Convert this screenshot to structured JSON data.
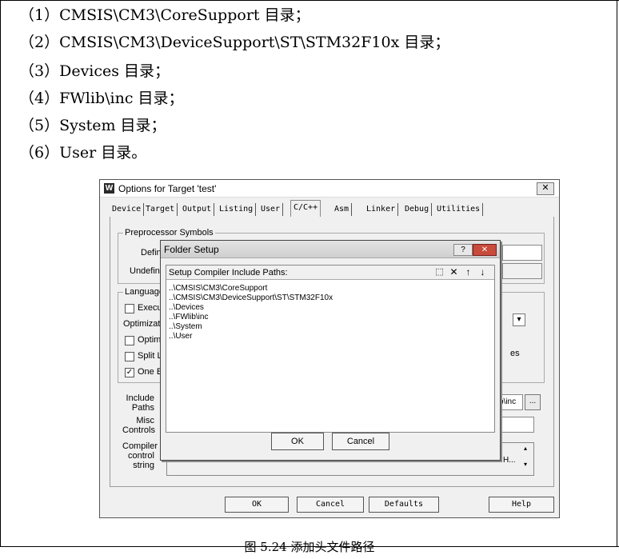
{
  "doc": {
    "lines": [
      "（1）CMSIS\\CM3\\CoreSupport 目录；",
      "（2）CMSIS\\CM3\\DeviceSupport\\ST\\STM32F10x 目录；",
      "（3）Devices 目录；",
      "（4）FWlib\\inc 目录；",
      "（5）System 目录；",
      "（6）User 目录。"
    ],
    "caption": "图 5.24   添加头文件路径"
  },
  "dialog": {
    "title": "Options for Target 'test'",
    "app_icon": "W",
    "close": "✕",
    "tabs": [
      "Device",
      "Target",
      "Output",
      "Listing",
      "User",
      "C/C++",
      "Asm",
      "Linker",
      "Debug",
      "Utilities"
    ],
    "active_tab": "C/C++",
    "preprocessor": {
      "group": "Preprocessor Symbols",
      "define": "Define",
      "undefine": "Undefine"
    },
    "language": {
      "group": "Language",
      "execute": "Execu",
      "optimization": "Optimizatic",
      "optimize": "Optim",
      "split": "Split L",
      "one": "One E",
      "right_dropdown": "▾",
      "right_text": "es"
    },
    "include_paths": {
      "label1": "Include",
      "label2": "Paths",
      "value": "b\\inc",
      "browse": "..."
    },
    "misc_controls": {
      "label1": "Misc",
      "label2": "Controls"
    },
    "compiler_string": {
      "label1": "Compiler",
      "label2": "control",
      "label3": "string",
      "value": "H..."
    },
    "buttons": {
      "ok": "OK",
      "cancel": "Cancel",
      "defaults": "Defaults",
      "help": "Help"
    }
  },
  "folder_setup": {
    "title": "Folder Setup",
    "help": "?",
    "close": "✕",
    "header": "Setup Compiler Include Paths:",
    "icons": [
      "new-folder-icon",
      "delete-icon",
      "move-up-icon",
      "move-down-icon"
    ],
    "paths": [
      "..\\CMSIS\\CM3\\CoreSupport",
      "..\\CMSIS\\CM3\\DeviceSupport\\ST\\STM32F10x",
      "..\\Devices",
      "..\\FWlib\\inc",
      "..\\System",
      "..\\User"
    ],
    "ok": "OK",
    "cancel": "Cancel"
  }
}
